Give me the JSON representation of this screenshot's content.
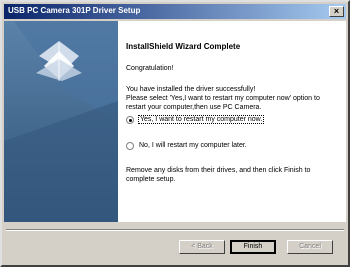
{
  "window": {
    "title": "USB PC Camera 301P Driver Setup"
  },
  "content": {
    "heading": "InstallShield Wizard Complete",
    "congratulation": "Congratulation!",
    "message_line1": "You have installed the driver successfully!",
    "message_line2": "Please select 'Yes,I want to restart my computer now' option to",
    "message_line3": "restart your computer,then use PC Camera.",
    "option_restart_now": "Yes, I want to restart my computer now.",
    "option_restart_later": "No, I will restart my computer later.",
    "remove_line1": "Remove any disks from their drives, and then click Finish to",
    "remove_line2": "complete setup.",
    "selected_option": "restart_now"
  },
  "buttons": {
    "back": "< Back",
    "finish": "Finish",
    "cancel": "Cancel"
  },
  "colors": {
    "titlebar_start": "#0a246a",
    "titlebar_end": "#a6caf0",
    "graphic_bg": "#3f678f",
    "desktop": "#3a6ea5"
  }
}
